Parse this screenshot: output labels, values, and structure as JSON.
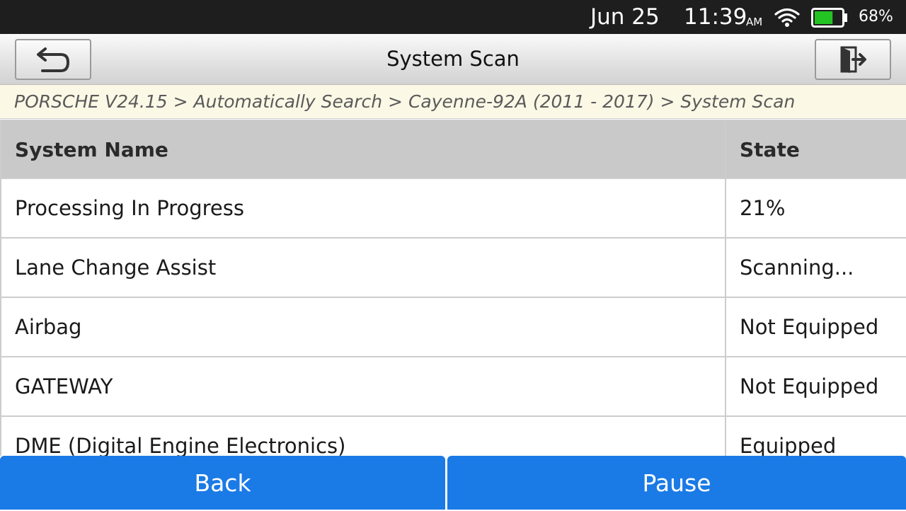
{
  "status_bar": {
    "date": "Jun 25",
    "time": "11:39",
    "ampm": "AM",
    "battery": "68%",
    "icons": [
      "wifi-icon",
      "battery-icon"
    ],
    "battery_color": "#22c322"
  },
  "title_bar": {
    "title": "System Scan",
    "left_icon": "back-arrow-icon",
    "right_icon": "exit-icon"
  },
  "breadcrumb": "PORSCHE V24.15 > Automatically Search > Cayenne-92A (2011 - 2017) > System Scan",
  "table": {
    "headers": [
      "System Name",
      "State"
    ],
    "rows": [
      [
        "Processing In Progress",
        "21%"
      ],
      [
        "Lane Change Assist",
        "Scanning..."
      ],
      [
        "Airbag",
        "Not Equipped"
      ],
      [
        "GATEWAY",
        "Not Equipped"
      ],
      [
        "DME (Digital Engine Electronics)",
        "Equipped"
      ]
    ]
  },
  "footer": {
    "back_label": "Back",
    "pause_label": "Pause",
    "accent": "#1a7ae6"
  }
}
